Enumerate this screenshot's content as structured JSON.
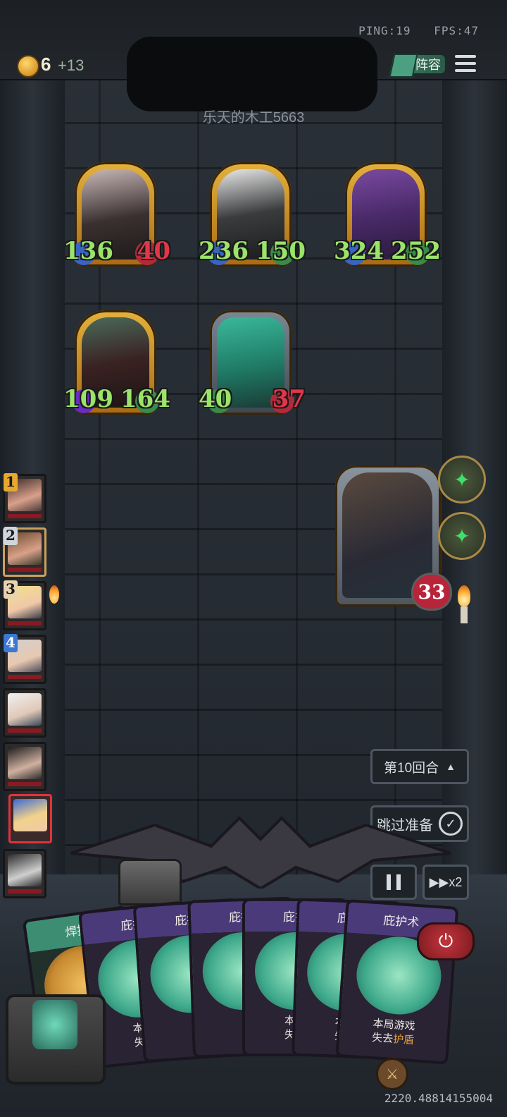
{
  "status": {
    "ping_label": "PING:19",
    "fps_label": "FPS:47"
  },
  "gold": {
    "count": "6",
    "bonus": "+13"
  },
  "header": {
    "lineup_label": "阵容",
    "opponent_name": "乐天的木工5663"
  },
  "enemy_units": [
    {
      "atk": "136",
      "hp": "40",
      "hp_color": "red"
    },
    {
      "atk": "236",
      "hp": "150",
      "hp_color": "green"
    },
    {
      "atk": "324",
      "hp": "252",
      "hp_color": "green"
    },
    {
      "atk": "109",
      "hp": "164",
      "hp_color": "green"
    },
    {
      "atk": "40",
      "hp": "37",
      "hp_color": "red"
    }
  ],
  "hero": {
    "hp": "33"
  },
  "roster": [
    {
      "rank": "1"
    },
    {
      "rank": "2"
    },
    {
      "rank": "3"
    },
    {
      "rank": "4"
    },
    {
      "rank": ""
    },
    {
      "rank": ""
    },
    {
      "rank": "",
      "active": true
    },
    {
      "rank": ""
    }
  ],
  "controls": {
    "round_label": "第10回合",
    "skip_label": "跳过准备",
    "speed_label": "x2"
  },
  "hand": [
    {
      "title": "焊接",
      "type": "green"
    },
    {
      "title": "庇护",
      "type": "purple",
      "desc1": "本局",
      "desc2": "失去"
    },
    {
      "title": "庇护",
      "type": "purple"
    },
    {
      "title": "庇护",
      "type": "purple"
    },
    {
      "title": "庇护",
      "type": "purple",
      "desc1": "本局",
      "desc2": "失去"
    },
    {
      "title": "庇护",
      "type": "purple",
      "desc1": "本局",
      "desc2": "失去"
    },
    {
      "title": "庇护术",
      "type": "purple",
      "desc1": "本局游戏",
      "desc2a": "失去",
      "desc2b": "护盾"
    }
  ],
  "debug": {
    "coords": "2220.48814155004"
  },
  "colors": {
    "atk_green": "#9be36a",
    "hp_red": "#e0374a",
    "frame_gold": "#e3b13c",
    "accent_red": "#c4343c"
  }
}
